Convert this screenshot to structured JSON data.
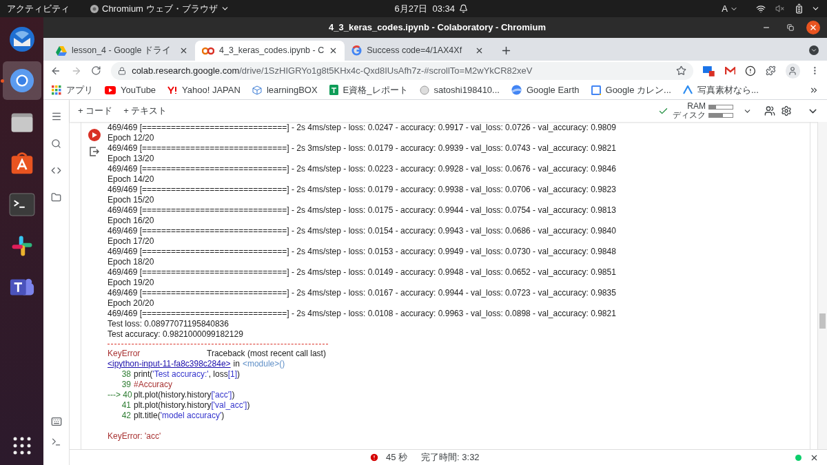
{
  "topbar": {
    "activities": "アクティビティ",
    "app": "Chromium ウェブ・ブラウザ",
    "clock": "6月27日  03:34",
    "input": "A"
  },
  "dock": [
    {
      "kind": "thunderbird",
      "selected": false
    },
    {
      "kind": "chromium",
      "selected": true
    },
    {
      "kind": "files",
      "selected": false
    },
    {
      "kind": "store",
      "selected": false
    },
    {
      "kind": "terminal",
      "selected": false
    },
    {
      "kind": "slack",
      "selected": false
    },
    {
      "kind": "teams",
      "selected": false
    }
  ],
  "window": {
    "title": "4_3_keras_codes.ipynb - Colaboratory - Chromium"
  },
  "tabs": [
    {
      "kind": "drive",
      "label": "lesson_4 - Google ドライ",
      "selected": false
    },
    {
      "kind": "colab",
      "label": "4_3_keras_codes.ipynb - C",
      "selected": true
    },
    {
      "kind": "google",
      "label": "Success code=4/1AX4Xf",
      "selected": false
    }
  ],
  "address": {
    "host": "colab.research.google.com",
    "path": "/drive/1SzHIGRYo1g8t5KHx4c-Qxd8IUsAfh7z-#scrollTo=M2wYkCR82xeV"
  },
  "bookmarks": [
    {
      "kind": "apps",
      "label": "アプリ"
    },
    {
      "kind": "youtube",
      "label": "YouTube"
    },
    {
      "kind": "yahoo",
      "label": "Yahoo! JAPAN"
    },
    {
      "kind": "learning",
      "label": "learningBOX"
    },
    {
      "kind": "sheets",
      "label": "E資格_レポート"
    },
    {
      "kind": "avatar",
      "label": "satoshi198410..."
    },
    {
      "kind": "earth",
      "label": "Google Earth"
    },
    {
      "kind": "calendar",
      "label": "Google カレン..."
    },
    {
      "kind": "photo",
      "label": "写真素材なら..."
    }
  ],
  "colab_toolbar": {
    "add_code": "+ コード",
    "add_text": "+ テキスト",
    "ram": {
      "label": "RAM",
      "level": 0.3
    },
    "disk": {
      "label": "ディスク",
      "level": 0.6
    }
  },
  "output": [
    "469/469 [==============================] - 2s 4ms/step - loss: 0.0247 - accuracy: 0.9917 - val_loss: 0.0726 - val_accuracy: 0.9809",
    "Epoch 12/20",
    "469/469 [==============================] - 2s 3ms/step - loss: 0.0179 - accuracy: 0.9939 - val_loss: 0.0743 - val_accuracy: 0.9821",
    "Epoch 13/20",
    "469/469 [==============================] - 2s 4ms/step - loss: 0.0223 - accuracy: 0.9928 - val_loss: 0.0676 - val_accuracy: 0.9846",
    "Epoch 14/20",
    "469/469 [==============================] - 2s 4ms/step - loss: 0.0179 - accuracy: 0.9938 - val_loss: 0.0706 - val_accuracy: 0.9823",
    "Epoch 15/20",
    "469/469 [==============================] - 2s 4ms/step - loss: 0.0175 - accuracy: 0.9944 - val_loss: 0.0754 - val_accuracy: 0.9813",
    "Epoch 16/20",
    "469/469 [==============================] - 2s 4ms/step - loss: 0.0154 - accuracy: 0.9943 - val_loss: 0.0686 - val_accuracy: 0.9840",
    "Epoch 17/20",
    "469/469 [==============================] - 2s 4ms/step - loss: 0.0153 - accuracy: 0.9949 - val_loss: 0.0730 - val_accuracy: 0.9848",
    "Epoch 18/20",
    "469/469 [==============================] - 2s 4ms/step - loss: 0.0149 - accuracy: 0.9948 - val_loss: 0.0652 - val_accuracy: 0.9851",
    "Epoch 19/20",
    "469/469 [==============================] - 2s 4ms/step - loss: 0.0167 - accuracy: 0.9944 - val_loss: 0.0723 - val_accuracy: 0.9835",
    "Epoch 20/20",
    "469/469 [==============================] - 2s 4ms/step - loss: 0.0108 - accuracy: 0.9963 - val_loss: 0.0898 - val_accuracy: 0.9821",
    "Test loss: 0.08977071195840836",
    "Test accuracy: 0.9821000099182129"
  ],
  "traceback": {
    "error": "KeyError",
    "heading": "Traceback (most recent call last)",
    "link": "<ipython-input-11-fa8c398c284e>",
    "in": "in",
    "module": "<module>()",
    "lines": [
      {
        "number": "38",
        "parts": [
          {
            "kind": "code",
            "text": "print("
          },
          {
            "kind": "string",
            "text": "'Test accuracy:'"
          },
          {
            "kind": "code",
            "text": ", loss"
          },
          {
            "kind": "string",
            "text": "[1]"
          },
          {
            "kind": "code",
            "text": ")"
          }
        ]
      },
      {
        "number": "39",
        "parts": [
          {
            "kind": "comment",
            "text": "#Accuracy"
          }
        ]
      },
      {
        "marker": "--->",
        "number": "40",
        "parts": [
          {
            "kind": "code",
            "text": "plt.plot(history.history"
          },
          {
            "kind": "string",
            "text": "['acc']"
          },
          {
            "kind": "code",
            "text": ")"
          }
        ]
      },
      {
        "number": "41",
        "parts": [
          {
            "kind": "code",
            "text": "plt.plot(history.history"
          },
          {
            "kind": "string",
            "text": "['val_acc']"
          },
          {
            "kind": "code",
            "text": ")"
          }
        ]
      },
      {
        "number": "42",
        "parts": [
          {
            "kind": "code",
            "text": "plt.title("
          },
          {
            "kind": "string",
            "text": "'model accuracy'"
          },
          {
            "kind": "code",
            "text": ")"
          }
        ]
      }
    ],
    "message": "KeyError: 'acc'"
  },
  "status_bar": {
    "elapsed": "45 秒",
    "completed": "完了時間: 3:32"
  }
}
